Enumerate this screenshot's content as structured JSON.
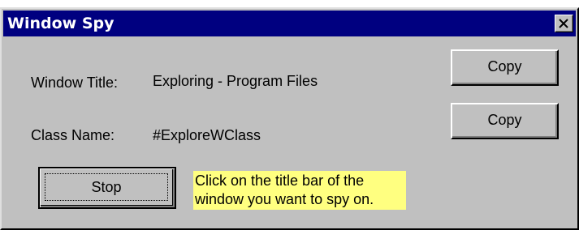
{
  "window": {
    "title": "Window Spy",
    "close_label": "close",
    "colors": {
      "titlebar": "#000080",
      "face": "#c0c0c0",
      "hint_background": "#ffff80"
    }
  },
  "fields": {
    "window_title": {
      "label": "Window Title:",
      "value": "Exploring - Program Files",
      "copy_label": "Copy"
    },
    "class_name": {
      "label": "Class Name:",
      "value": "#ExploreWClass",
      "copy_label": "Copy"
    }
  },
  "actions": {
    "stop_label": "Stop"
  },
  "hint": {
    "line1": "Click on the title bar of the",
    "line2": "window you want to spy on."
  },
  "icons": {
    "close": "close-icon"
  }
}
